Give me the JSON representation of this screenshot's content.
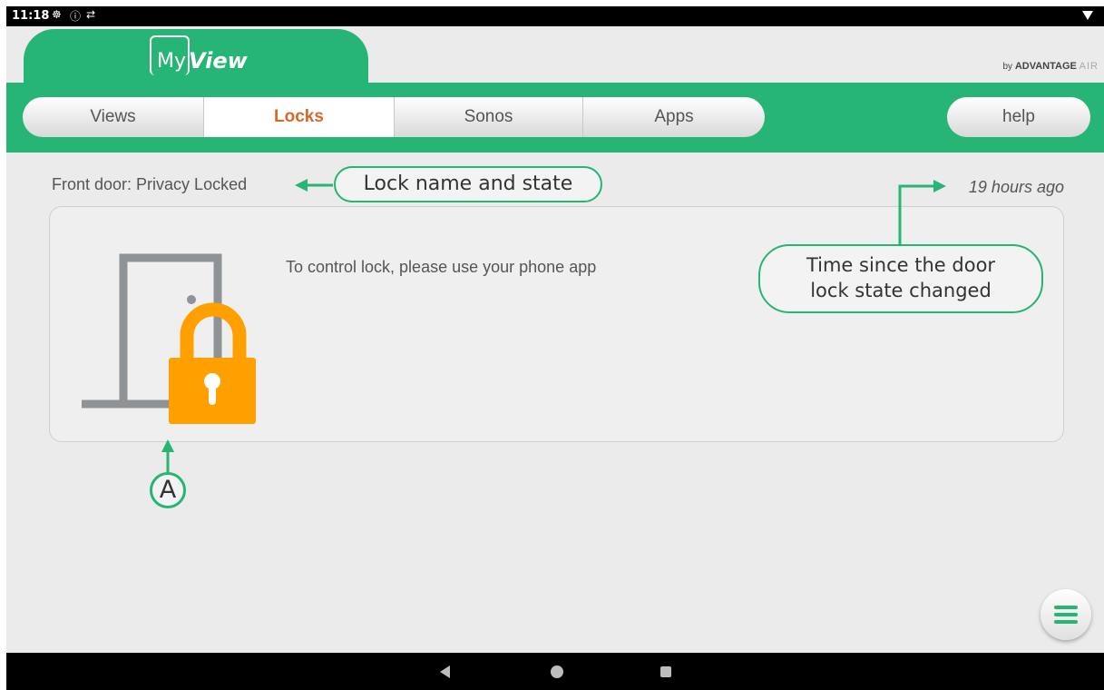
{
  "status_bar": {
    "time": "11:18",
    "icons": [
      "pin-icon",
      "info-icon",
      "sync-icon",
      "wifi-icon"
    ]
  },
  "header": {
    "logo_my": "My",
    "logo_view": "View",
    "brand_by": "by",
    "brand_name": "ADVANTAGE",
    "brand_air": "AIR"
  },
  "nav": {
    "tabs": [
      {
        "label": "Views",
        "active": false
      },
      {
        "label": "Locks",
        "active": true
      },
      {
        "label": "Sonos",
        "active": false
      },
      {
        "label": "Apps",
        "active": false
      }
    ],
    "help_label": "help"
  },
  "lock": {
    "title": "Front door: Privacy Locked",
    "last_changed": "19 hours ago",
    "message": "To control lock, please use your phone app"
  },
  "annotations": {
    "name_callout": "Lock name and state",
    "time_callout_line1": "Time since the door",
    "time_callout_line2": "lock state changed",
    "marker": "A"
  },
  "colors": {
    "accent": "#26b574",
    "active_tab": "#d46a2b",
    "lock_icon": "#ffa000",
    "door": "#8f9396"
  }
}
